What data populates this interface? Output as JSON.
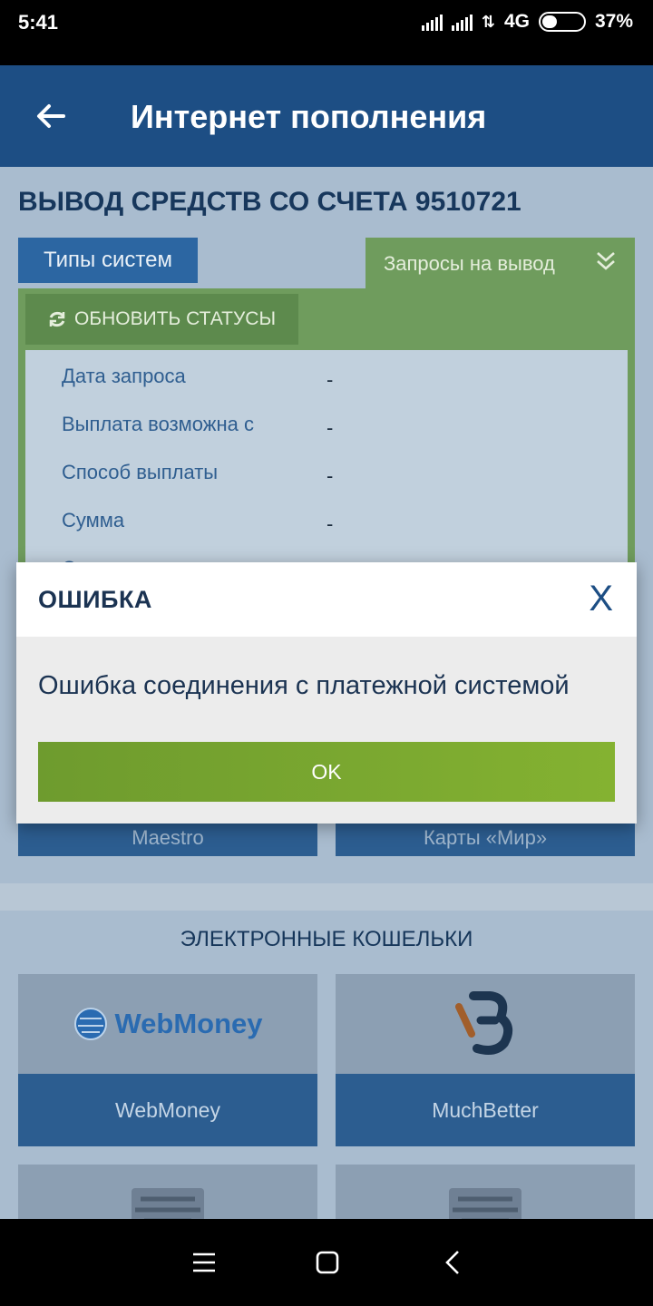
{
  "status_bar": {
    "time": "5:41",
    "network": "4G",
    "battery": "37%"
  },
  "app_bar": {
    "title": "Интернет пополнения"
  },
  "account": {
    "title": "ВЫВОД СРЕДСТВ СО СЧЕТА 9510721"
  },
  "tabs": {
    "types": "Типы систем",
    "requests": "Запросы на вывод"
  },
  "refresh": {
    "label": "ОБНОВИТЬ СТАТУСЫ"
  },
  "requests": {
    "rows": [
      {
        "label": "Дата запроса",
        "value": "-"
      },
      {
        "label": "Выплата возможна с",
        "value": "-"
      },
      {
        "label": "Способ выплаты",
        "value": "-"
      },
      {
        "label": "Сумма",
        "value": "-"
      },
      {
        "label": "Статус",
        "value": ""
      }
    ]
  },
  "cards": {
    "left": "Maestro",
    "right": "Карты «Мир»"
  },
  "wallets": {
    "section_title": "ЭЛЕКТРОННЫЕ КОШЕЛЬКИ",
    "items": [
      {
        "name": "WebMoney",
        "logo_text": "WebMoney"
      },
      {
        "name": "MuchBetter"
      }
    ]
  },
  "dialog": {
    "title": "ОШИБКА",
    "close": "X",
    "message": "Ошибка соединения с платежной системой",
    "ok": "OK"
  },
  "colors": {
    "app_bar": "#1d4e84",
    "ok_button": "#84b231",
    "tab_active": "#6f9c5d"
  }
}
